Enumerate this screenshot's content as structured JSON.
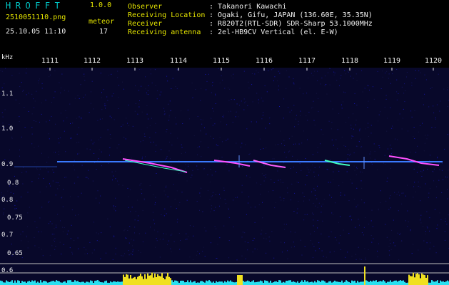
{
  "app": {
    "logo": "HROFFT",
    "version": "1.0.0"
  },
  "file": {
    "name": "2510051110.png",
    "datetime": "25.10.05 11:10",
    "counter_label": "meteor",
    "counter_value": "17"
  },
  "info": [
    {
      "label": "Observer",
      "value": ": Takanori Kawachi"
    },
    {
      "label": "Receiving Location",
      "value": ": Ogaki, Gifu, JAPAN (136.60E, 35.35N)"
    },
    {
      "label": "Receiver",
      "value": ": R820T2(RTL-SDR) SDR-Sharp 53.1000MHz"
    },
    {
      "label": "Receiving antenna",
      "value": ": 2el-HB9CV Vertical (el. E-W)"
    }
  ],
  "axis": {
    "y_unit": "kHz",
    "x_ticks": [
      "1111",
      "1112",
      "1113",
      "1114",
      "1115",
      "1116",
      "1117",
      "1118",
      "1119",
      "1120"
    ],
    "y_ticks": [
      "1.1",
      "1.0",
      "0.9",
      "0.8",
      "0.7",
      "0.6"
    ],
    "y_ticks_minor": [
      "0.9",
      "0.8",
      "0.75",
      "0.7",
      "0.65",
      "0.6"
    ]
  },
  "colors": {
    "background": "#000000",
    "plot_bg": "#08082a",
    "logo": "#00c8c8",
    "label": "#e6e600",
    "text": "#f0f0f0",
    "signal": "#2b5cff",
    "trace_hot": "#ff50ff",
    "trace_mid": "#40ffc0",
    "bar_cyan": "#28e0f0",
    "bar_yellow": "#f0e020"
  }
}
